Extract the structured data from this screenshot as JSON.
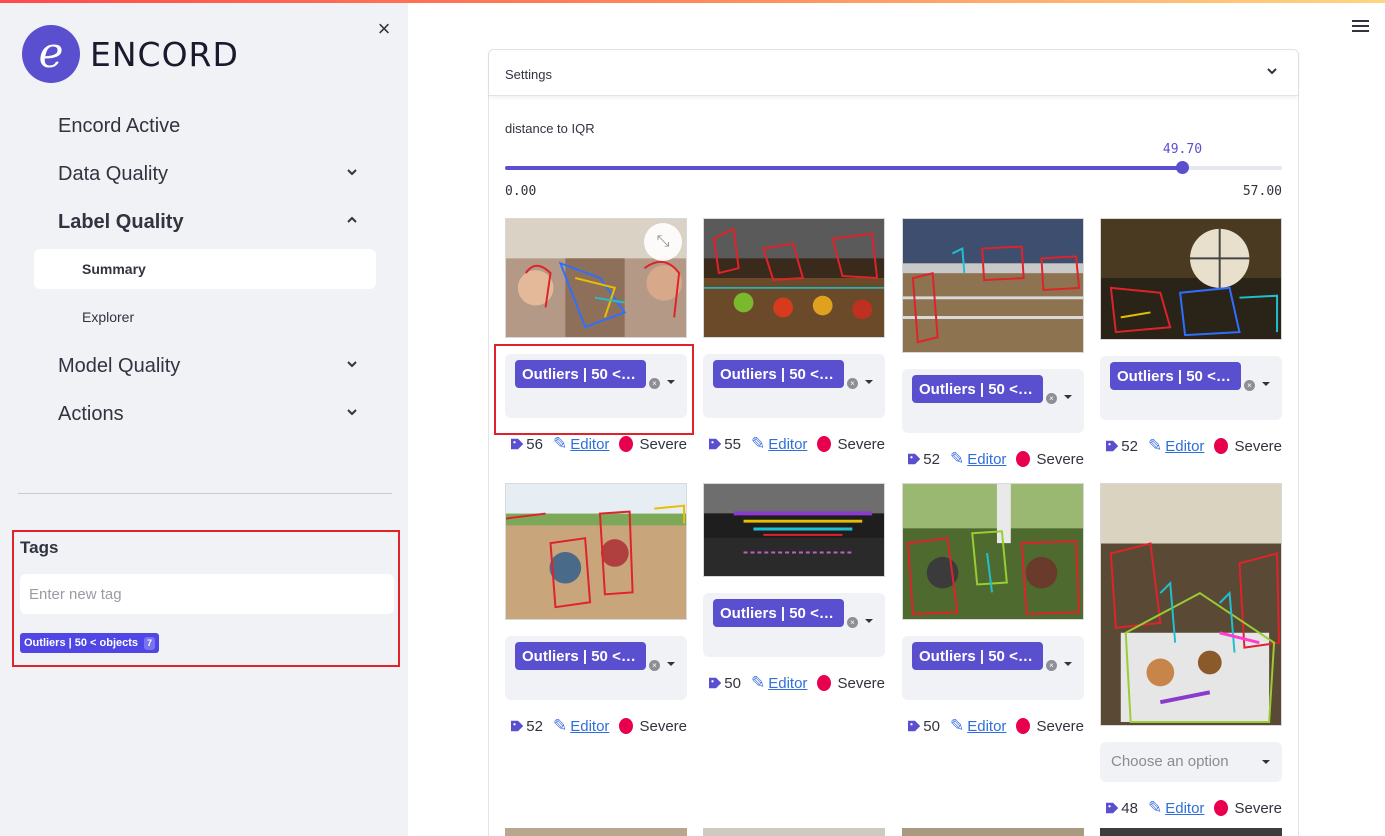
{
  "sidebar": {
    "logo_text": "ENCORD",
    "logo_letter": "e",
    "close_icon": "close-icon",
    "nav": {
      "encord_active": "Encord Active",
      "data_quality": "Data Quality",
      "label_quality": "Label Quality",
      "summary": "Summary",
      "explorer": "Explorer",
      "model_quality": "Model Quality",
      "actions": "Actions"
    },
    "tags": {
      "title": "Tags",
      "placeholder": "Enter new tag",
      "chip_label": "Outliers | 50 < objects",
      "chip_count": "7"
    }
  },
  "main": {
    "settings_label": "Settings",
    "slider": {
      "label": "distance to IQR",
      "value": "49.70",
      "min": "0.00",
      "max": "57.00",
      "fraction": 0.8719
    },
    "tag_option": "Outliers | 50 < objects",
    "choose_placeholder": "Choose an option",
    "editor_label": "Editor",
    "severity_label": "Severe",
    "cards": [
      {
        "count": "56"
      },
      {
        "count": "55"
      },
      {
        "count": "52"
      },
      {
        "count": "52"
      },
      {
        "count": "52"
      },
      {
        "count": "50"
      },
      {
        "count": "50"
      },
      {
        "count": "48"
      }
    ]
  },
  "colors": {
    "accent": "#5a4fcf",
    "severe": "#e8004f",
    "highlight": "#e0222b",
    "link": "#2f6fdb"
  }
}
